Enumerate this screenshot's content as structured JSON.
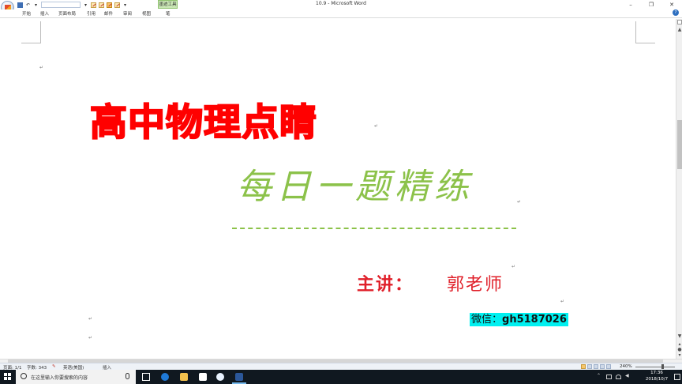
{
  "window": {
    "title": "10.9 - Microsoft Word",
    "context_tab": "墨迹工具",
    "controls": [
      "–",
      "❐",
      "✕"
    ]
  },
  "ribbon": {
    "tabs": [
      "开始",
      "插入",
      "页面布局",
      "引用",
      "邮件",
      "审阅",
      "视图",
      "笔"
    ],
    "help": "?"
  },
  "document": {
    "title": "高中物理点睛",
    "subtitle": "每日一题精练",
    "lecturer_label": "主讲：",
    "lecturer_name": "郭老师",
    "wechat_label": "微信：",
    "wechat_id": "gh5187026",
    "para_mark": "↵",
    "colors": {
      "title": "#ff0000",
      "subtitle": "#8cc24a",
      "lecturer": "#e0202a",
      "highlight": "#00f0f0"
    }
  },
  "statusbar": {
    "page": "页面: 1/1",
    "words": "字数: 343",
    "language": "英语(美国)",
    "insert_mode": "插入",
    "zoom": "240%"
  },
  "taskbar": {
    "search_placeholder": "在这里输入你要搜索的内容",
    "apps": [
      "task-view",
      "edge",
      "explorer",
      "store",
      "baidu-netdisk",
      "word"
    ],
    "time": "17:36",
    "date": "2018/10/7"
  }
}
